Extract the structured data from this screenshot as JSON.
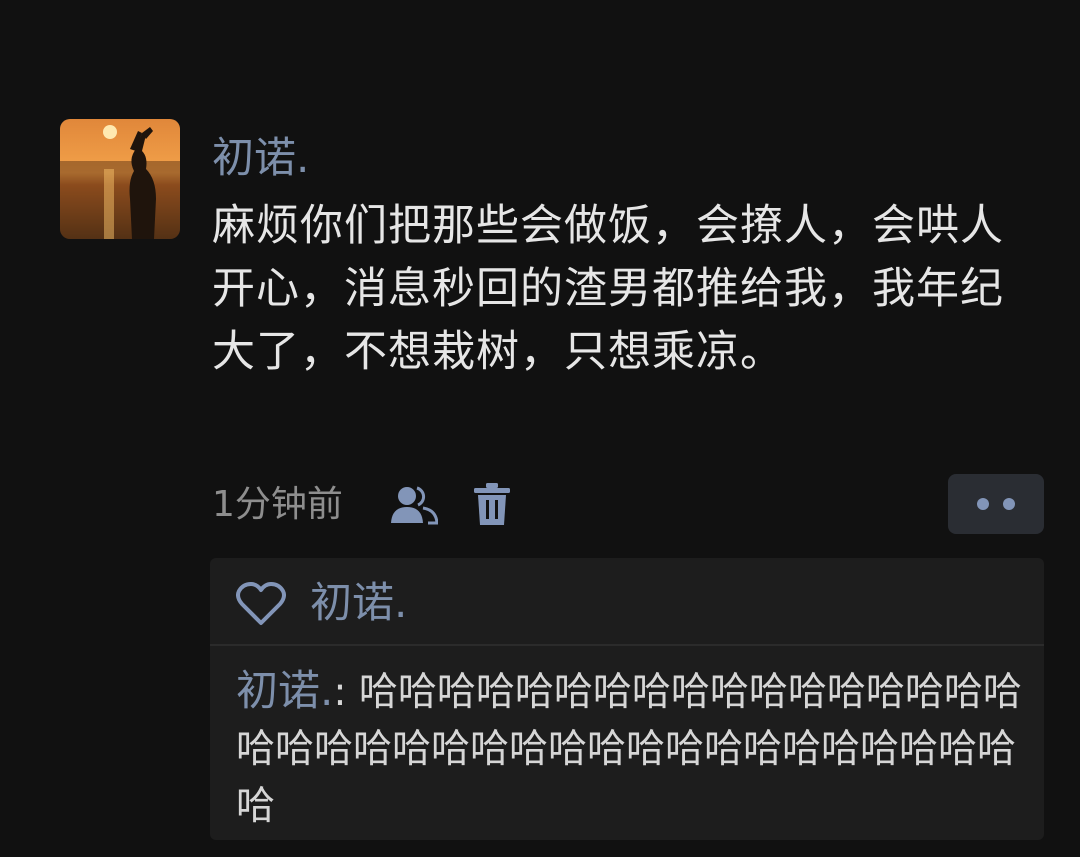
{
  "post": {
    "author": "初诺.",
    "content": "麻烦你们把那些会做饭，会撩人，会哄人开心，消息秒回的渣男都推给我，我年纪大了，不想栽树，只想乘凉。",
    "time": "1分钟前"
  },
  "icons": {
    "friends": "friends-visibility-icon",
    "trash": "trash-icon",
    "more": "more-dots-icon",
    "heart": "heart-icon"
  },
  "likes": {
    "names": "初诺."
  },
  "comments": [
    {
      "author": "初诺.",
      "separator": ": ",
      "text": "哈哈哈哈哈哈哈哈哈哈哈哈哈哈哈哈哈哈哈哈哈哈哈哈哈哈哈哈哈哈哈哈哈哈哈哈哈哈"
    }
  ],
  "colors": {
    "background": "#111111",
    "name_link": "#7d8fab",
    "text": "#e6e6e6",
    "meta": "#8e8e8e",
    "comment_bg": "#1d1d1d"
  }
}
